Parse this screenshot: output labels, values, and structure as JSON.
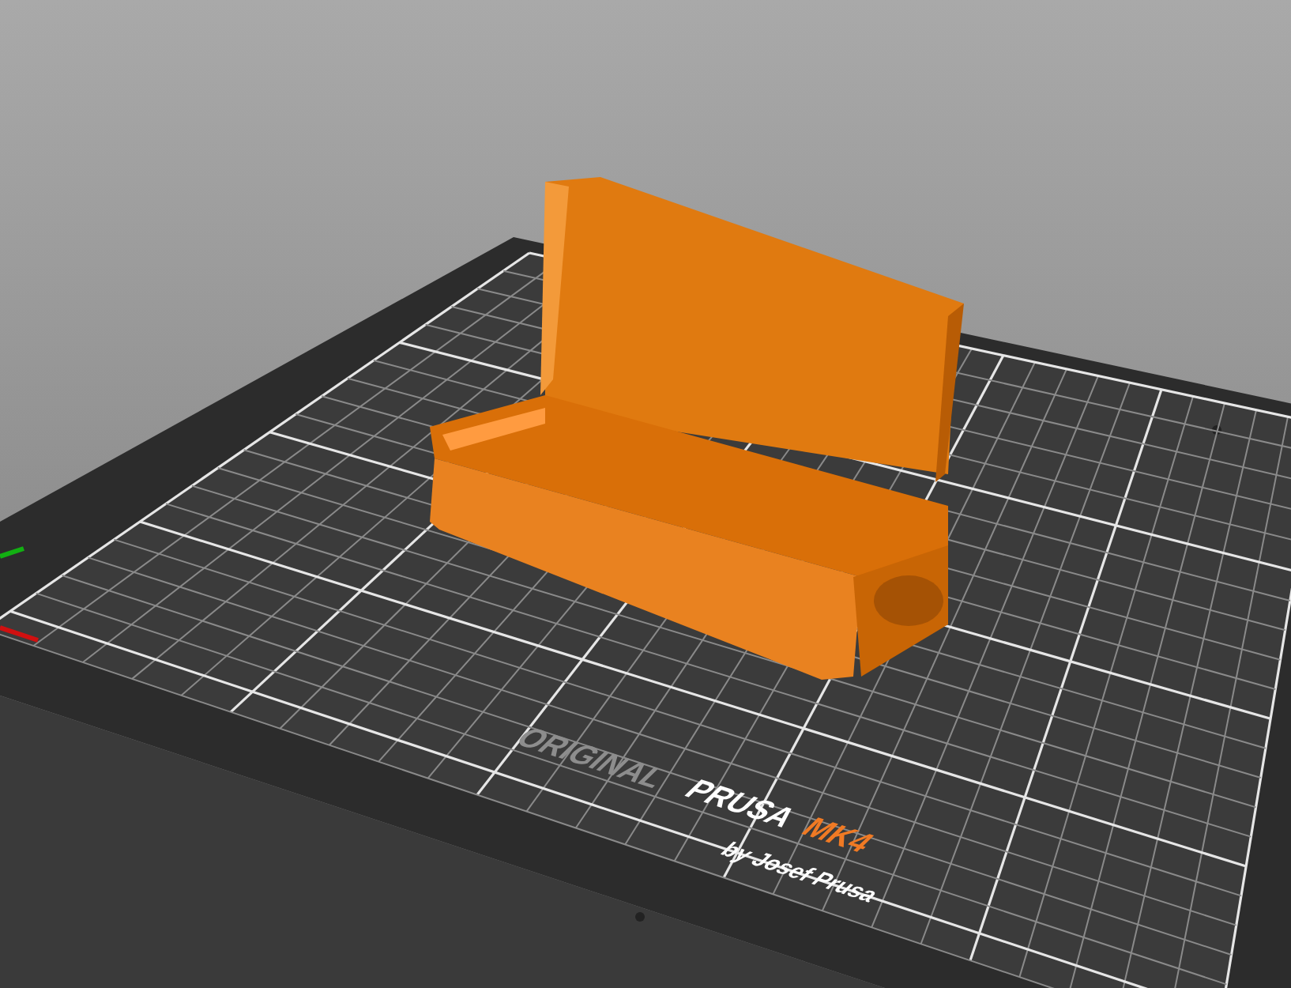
{
  "bed_logo": {
    "prefix": "ORIGINAL",
    "brand": "PRUSA",
    "model": "MK4",
    "byline": "by Josef Prusa"
  }
}
